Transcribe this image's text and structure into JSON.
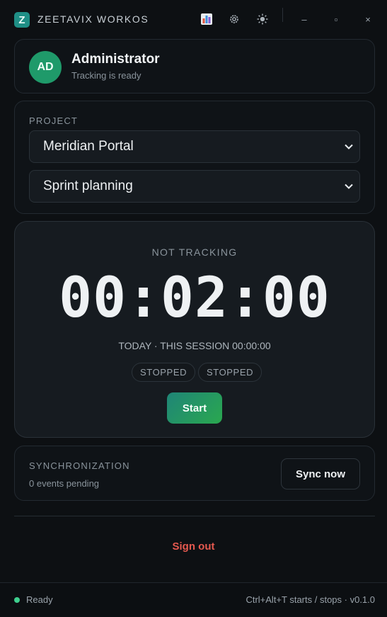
{
  "window": {
    "logo_letter": "Z",
    "title": "ZEETAVIX WORKOS",
    "icons": [
      "chart-icon",
      "gear-icon",
      "sun-icon"
    ],
    "controls": {
      "minimize": "–",
      "maximize": "▫",
      "close": "×"
    }
  },
  "user": {
    "initials": "AD",
    "name": "Administrator",
    "status": "Tracking is ready"
  },
  "project": {
    "label": "PROJECT",
    "project_select": "Meridian Portal",
    "task_select": "Sprint planning"
  },
  "timer": {
    "state": "NOT TRACKING",
    "hours": "00",
    "minutes": "02",
    "seconds": "00",
    "session_line": "TODAY · THIS SESSION 00:00:00",
    "pill_1": "STOPPED",
    "pill_2": "STOPPED",
    "start_label": "Start"
  },
  "sync": {
    "label": "SYNCHRONIZATION",
    "pending": "0 events pending",
    "button": "Sync now"
  },
  "sign_out": "Sign out",
  "statusbar": {
    "status": "Ready",
    "shortcut": "Ctrl+Alt+T starts / stops · v0.1.0"
  },
  "colors": {
    "accent": "#1f8f86",
    "start_gradient": [
      "#1f8577",
      "#2aa84f"
    ],
    "danger": "#e5594f",
    "ready": "#3ecf8e"
  }
}
